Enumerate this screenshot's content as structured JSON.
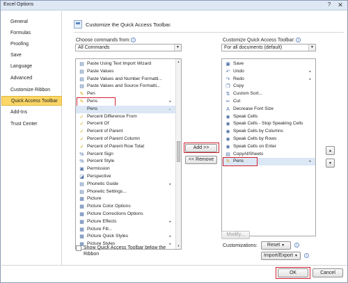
{
  "window": {
    "title": "Excel Options",
    "help_glyph": "?",
    "close_glyph": "✕"
  },
  "sidebar": {
    "items": [
      {
        "label": "General"
      },
      {
        "label": "Formulas"
      },
      {
        "label": "Proofing"
      },
      {
        "label": "Save"
      },
      {
        "label": "Language"
      },
      {
        "label": "Advanced"
      },
      {
        "label": "Customize Ribbon"
      },
      {
        "label": "Quick Access Toolbar",
        "active": true
      },
      {
        "label": "Add-Ins"
      },
      {
        "label": "Trust Center"
      }
    ]
  },
  "main": {
    "header": "Customize the Quick Access Toolbar.",
    "choose_label": "Choose commands from:",
    "choose_value": "All Commands",
    "customize_label": "Customize Quick Access Toolbar:",
    "customize_value": "For all documents (default)",
    "left_list": [
      {
        "label": "Paste Using Text Import Wizard",
        "icon": "paste-icon",
        "glyph": "▤"
      },
      {
        "label": "Paste Values",
        "icon": "paste-values-icon",
        "glyph": "▤"
      },
      {
        "label": "Paste Values and Number Formatti...",
        "icon": "paste-icon",
        "glyph": "▤"
      },
      {
        "label": "Paste Values and Source Formatti...",
        "icon": "paste-icon",
        "glyph": "▤"
      },
      {
        "label": "Pen",
        "icon": "pen-icon",
        "glyph": "✎"
      },
      {
        "label": "Pens",
        "icon": "pens-icon",
        "glyph": "✎",
        "submenu": true,
        "highlight": true
      },
      {
        "label": "Pens",
        "icon": "",
        "glyph": "",
        "submenu_down": true,
        "selected": true
      },
      {
        "label": "Percent Difference From",
        "icon": "check-icon",
        "glyph": "✓"
      },
      {
        "label": "Percent Of",
        "icon": "check-icon",
        "glyph": "✓"
      },
      {
        "label": "Percent of Parent",
        "icon": "check-icon",
        "glyph": "✓"
      },
      {
        "label": "Percent of Parent Column",
        "icon": "check-icon",
        "glyph": "✓"
      },
      {
        "label": "Percent of Parent Row Total",
        "icon": "check-icon",
        "glyph": "✓"
      },
      {
        "label": "Percent Sign",
        "icon": "percent-icon",
        "glyph": "%"
      },
      {
        "label": "Percent Style",
        "icon": "percent-icon",
        "glyph": "%"
      },
      {
        "label": "Permission",
        "icon": "permission-icon",
        "glyph": "▣"
      },
      {
        "label": "Perspective",
        "icon": "perspective-icon",
        "glyph": "◪"
      },
      {
        "label": "Phonetic Guide",
        "icon": "phonetic-icon",
        "glyph": "▤",
        "submenu": true
      },
      {
        "label": "Phonetic Settings...",
        "icon": "phonetic-settings-icon",
        "glyph": "▤"
      },
      {
        "label": "Picture",
        "icon": "picture-icon",
        "glyph": "▦"
      },
      {
        "label": "Picture Color Options",
        "icon": "picture-color-icon",
        "glyph": "▦"
      },
      {
        "label": "Picture Corrections Options",
        "icon": "picture-corrections-icon",
        "glyph": "▦"
      },
      {
        "label": "Picture Effects",
        "icon": "picture-effects-icon",
        "glyph": "▦",
        "submenu": true
      },
      {
        "label": "Picture Fill...",
        "icon": "picture-fill-icon",
        "glyph": "▦"
      },
      {
        "label": "Picture Quick Styles",
        "icon": "picture-styles-icon",
        "glyph": "▦",
        "submenu": true
      },
      {
        "label": "Picture Styles",
        "icon": "picture-styles-icon",
        "glyph": "▦",
        "submenu": true
      }
    ],
    "right_list": [
      {
        "label": "Save",
        "icon": "save-icon",
        "glyph": "▣"
      },
      {
        "label": "Undo",
        "icon": "undo-icon",
        "glyph": "↶",
        "submenu": true
      },
      {
        "label": "Redo",
        "icon": "redo-icon",
        "glyph": "↷",
        "submenu": true
      },
      {
        "label": "Copy",
        "icon": "copy-icon",
        "glyph": "❐"
      },
      {
        "label": "Custom Sort...",
        "icon": "sort-icon",
        "glyph": "⇅"
      },
      {
        "label": "Cut",
        "icon": "cut-icon",
        "glyph": "✂"
      },
      {
        "label": "Decrease Font Size",
        "icon": "decrease-font-icon",
        "glyph": "A"
      },
      {
        "label": "Speak Cells",
        "icon": "speak-icon",
        "glyph": "◉"
      },
      {
        "label": "Speak Cells - Stop Speaking Cells",
        "icon": "speak-stop-icon",
        "glyph": "◉"
      },
      {
        "label": "Speak Cells by Columns",
        "icon": "speak-columns-icon",
        "glyph": "◉"
      },
      {
        "label": "Speak Cells by Rows",
        "icon": "speak-rows-icon",
        "glyph": "◉"
      },
      {
        "label": "Speak Cells on Enter",
        "icon": "speak-enter-icon",
        "glyph": "◉"
      },
      {
        "label": "CopyAllSheets",
        "icon": "macro-icon",
        "glyph": "▤"
      },
      {
        "label": "Pens",
        "icon": "pens-icon",
        "glyph": "✎",
        "submenu": true,
        "highlight": true,
        "selected": true
      }
    ],
    "add_label": "Add >>",
    "remove_label": "<< Remove",
    "modify_label": "Modify...",
    "customizations_label": "Customizations:",
    "reset_label": "Reset",
    "import_export_label": "Import/Export",
    "show_qat_label_1": "Show Quick Access Toolbar below the",
    "show_qat_label_2": "Ribbon",
    "move_up_glyph": "▲",
    "move_down_glyph": "▼",
    "info_glyph": "i",
    "dropdown_glyph": "▼",
    "submenu_glyph": "▸",
    "submenu_down_glyph": "⌄"
  },
  "footer": {
    "ok_label": "OK",
    "cancel_label": "Cancel"
  },
  "colors": {
    "active_nav": "#fcd666",
    "highlight_red": "#d21f2e",
    "selection": "#dbe7f5"
  }
}
